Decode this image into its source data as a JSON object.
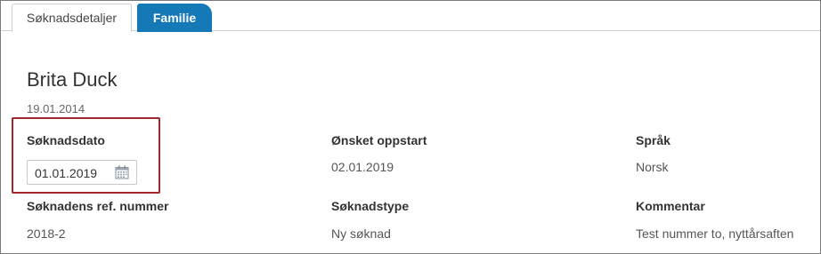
{
  "tabs": [
    {
      "label": "Søknadsdetaljer",
      "active": false
    },
    {
      "label": "Familie",
      "active": true
    }
  ],
  "applicant": {
    "name": "Brita Duck",
    "birth_date": "19.01.2014"
  },
  "fields": {
    "application_date": {
      "label": "Søknadsdato",
      "value": "01.01.2019"
    },
    "desired_start": {
      "label": "Ønsket oppstart",
      "value": "02.01.2019"
    },
    "language": {
      "label": "Språk",
      "value": "Norsk"
    },
    "ref_number": {
      "label": "Søknadens ref. nummer",
      "value": "2018-2"
    },
    "application_type": {
      "label": "Søknadstype",
      "value": "Ny søknad"
    },
    "comment": {
      "label": "Kommentar",
      "value": "Test nummer to, nyttårsaften"
    }
  },
  "icons": {
    "date_picker": "calendar-icon"
  },
  "colors": {
    "accent": "#1579b8",
    "highlight": "#a0262a"
  }
}
